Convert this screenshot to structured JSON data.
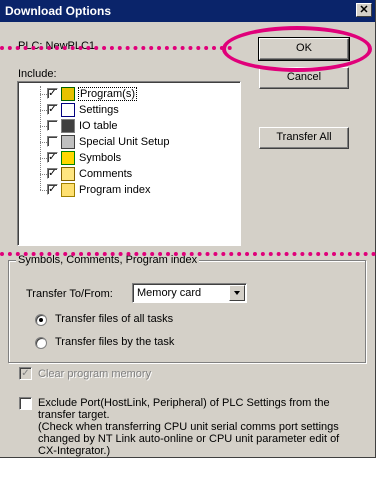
{
  "window": {
    "title": "Download Options",
    "close_glyph": "✕"
  },
  "plc_label": "PLC: NewPLC1",
  "include_label": "Include:",
  "buttons": {
    "ok": "OK",
    "cancel": "Cancel",
    "transfer_all": "Transfer All"
  },
  "tree": [
    {
      "label": "Program(s)",
      "checked": true,
      "icon": "program-icon",
      "selected": true
    },
    {
      "label": "Settings",
      "checked": true,
      "icon": "settings-icon"
    },
    {
      "label": "IO table",
      "checked": false,
      "icon": "io-table-icon"
    },
    {
      "label": "Special Unit Setup",
      "checked": false,
      "icon": "special-unit-icon"
    },
    {
      "label": "Symbols",
      "checked": true,
      "icon": "symbols-icon"
    },
    {
      "label": "Comments",
      "checked": true,
      "icon": "comments-icon"
    },
    {
      "label": "Program index",
      "checked": true,
      "icon": "folder-icon"
    }
  ],
  "group": {
    "title": "Symbols, Comments, Program index",
    "transfer_label": "Transfer To/From:",
    "transfer_value": "Memory card",
    "radio_all": "Transfer files of all tasks",
    "radio_task": "Transfer files by the task"
  },
  "clear_memory": "Clear program memory",
  "exclude_port": {
    "line1": "Exclude Port(HostLink, Peripheral) of PLC Settings from the",
    "line2": "transfer target.",
    "line3": "(Check when transferring CPU unit serial comms port settings",
    "line4": "changed by NT Link auto-online or CPU unit parameter edit of",
    "line5": "CX-Integrator.)"
  },
  "colors": {
    "highlight": "#e0007a",
    "titlebar": "#0a246a",
    "face": "#d4d0c8"
  }
}
